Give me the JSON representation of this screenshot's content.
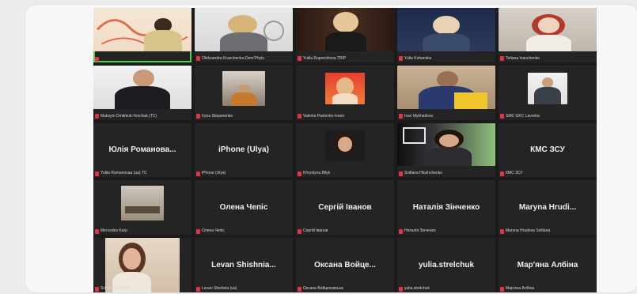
{
  "participants": [
    {
      "tag": "",
      "display": "",
      "video": true
    },
    {
      "tag": "Oleksandra Kravchenko-Dem'Phylo",
      "display": "",
      "video": true
    },
    {
      "tag": "Yuliia Ruprechtova TRIP",
      "display": "",
      "video": true
    },
    {
      "tag": "Yulia Kohanska",
      "display": "",
      "video": true
    },
    {
      "tag": "Tetiana Ivanchenko",
      "display": "",
      "video": true
    },
    {
      "tag": "Maksym Dmitriiuk-Yevchuk (TC)",
      "display": "",
      "video": true
    },
    {
      "tag": "Iryna Stepanenko",
      "display": "",
      "video": true
    },
    {
      "tag": "Valeriia Pavlenko-Ivano",
      "display": "",
      "video": true
    },
    {
      "tag": "Ivan Mykhailova",
      "display": "",
      "video": true
    },
    {
      "tag": "SMC GKC Lavreha",
      "display": "",
      "video": true
    },
    {
      "tag": "Yuliia Romanovaa (ua) TC",
      "display": "Юлія Романова...",
      "video": false
    },
    {
      "tag": "iPhone (Ulya)",
      "display": "iPhone (Ulya)",
      "video": false
    },
    {
      "tag": "Khrystyna Bilyk",
      "display": "",
      "video": true
    },
    {
      "tag": "Svitlana Hlushchenko",
      "display": "",
      "video": true
    },
    {
      "tag": "КМС ЗСУ",
      "display": "КМС ЗСУ",
      "video": false
    },
    {
      "tag": "Mercedes Karp",
      "display": "",
      "video": true
    },
    {
      "tag": "Олена Чепіс",
      "display": "Олена Чепіс",
      "video": false
    },
    {
      "tag": "Сергій Іванов",
      "display": "Сергій Іванов",
      "video": false
    },
    {
      "tag": "Наталія Зінченко",
      "display": "Наталія Зінченко",
      "video": false
    },
    {
      "tag": "Maryna Hrudova Svitlana",
      "display": "Maryna Hrudi...",
      "video": false
    },
    {
      "tag": "Svitlana Pavlova",
      "display": "",
      "video": true
    },
    {
      "tag": "Levan Shishnia (ua)",
      "display": "Levan Shishnia...",
      "video": false
    },
    {
      "tag": "Оксана Войцеховська",
      "display": "Оксана Войце...",
      "video": false
    },
    {
      "tag": "yulia.stretchuk",
      "display": "yulia.strelchuk",
      "video": false
    },
    {
      "tag": "Мар'яна Албіна",
      "display": "Мар'яна Албіна",
      "video": false
    }
  ],
  "colors": {
    "grid_bg": "#1b1b1b",
    "tile_bg": "#242424",
    "active_border": "#49d14f",
    "mic_muted": "#e5333f"
  }
}
